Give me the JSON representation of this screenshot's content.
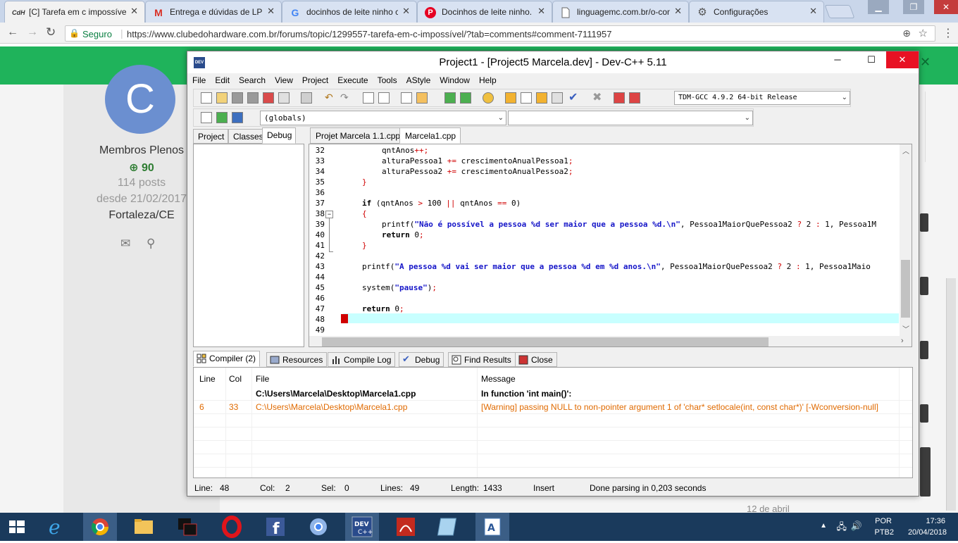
{
  "browser": {
    "tabs": [
      {
        "favicon": "CdH",
        "title": "[C] Tarefa em c impossíve",
        "active": true
      },
      {
        "favicon": "M",
        "title": "Entrega e dúvidas de LPC",
        "active": false
      },
      {
        "favicon": "G",
        "title": "docinhos de leite ninho c",
        "active": false
      },
      {
        "favicon": "P",
        "title": "Docinhos de leite ninho.",
        "active": false
      },
      {
        "favicon": "doc",
        "title": "linguagemc.com.br/o-con",
        "active": false
      },
      {
        "favicon": "gear",
        "title": "Configurações",
        "active": false
      }
    ],
    "secure_label": "Seguro",
    "url": "https://www.clubedohardware.com.br/forums/topic/1299557-tarefa-em-c-impossível/?tab=comments#comment-7111957"
  },
  "profile": {
    "avatar_letter": "C",
    "group": "Membros Plenos",
    "reputation": "90",
    "posts": "114 posts",
    "since": "desde 21/02/2017",
    "location": "Fortaleza/CE"
  },
  "right_date": "12 de abril",
  "devcpp": {
    "title": "Project1 - [Project5 Marcela.dev] - Dev-C++ 5.11",
    "menu": [
      "File",
      "Edit",
      "Search",
      "View",
      "Project",
      "Execute",
      "Tools",
      "AStyle",
      "Window",
      "Help"
    ],
    "compiler_select": "TDM-GCC 4.9.2 64-bit Release",
    "scope_select": "(globals)",
    "left_tabs": [
      "Project",
      "Classes",
      "Debug"
    ],
    "editor_tabs": [
      "Projet Marcela 1.1.cpp",
      "Marcela1.cpp"
    ],
    "code_lines": [
      {
        "n": "32",
        "text": "qntAnos++;"
      },
      {
        "n": "33",
        "text": "alturaPessoa1 += crescimentoAnualPessoa1;"
      },
      {
        "n": "34",
        "text": "alturaPessoa2 += crescimentoAnualPessoa2;"
      },
      {
        "n": "35",
        "text": "}"
      },
      {
        "n": "36",
        "text": ""
      },
      {
        "n": "37",
        "text": "if (qntAnos > 100 || qntAnos == 0)"
      },
      {
        "n": "38",
        "text": "{"
      },
      {
        "n": "39",
        "text": "printf(\"Não é possível a pessoa %d ser maior que a pessoa %d.\\n\", Pessoa1MaiorQuePessoa2 ? 2 : 1, Pessoa1M"
      },
      {
        "n": "40",
        "text": "return 0;"
      },
      {
        "n": "41",
        "text": "}"
      },
      {
        "n": "42",
        "text": ""
      },
      {
        "n": "43",
        "text": "printf(\"A pessoa %d vai ser maior que a pessoa %d em %d anos.\\n\", Pessoa1MaiorQuePessoa2 ? 2 : 1, Pessoa1Maio"
      },
      {
        "n": "44",
        "text": ""
      },
      {
        "n": "45",
        "text": "system(\"pause\");"
      },
      {
        "n": "46",
        "text": ""
      },
      {
        "n": "47",
        "text": "return 0;"
      },
      {
        "n": "48",
        "text": "}"
      },
      {
        "n": "49",
        "text": ""
      }
    ],
    "bottom_tabs": [
      "Compiler (2)",
      "Resources",
      "Compile Log",
      "Debug",
      "Find Results",
      "Close"
    ],
    "msg_headers": {
      "line": "Line",
      "col": "Col",
      "file": "File",
      "message": "Message"
    },
    "messages": [
      {
        "line": "",
        "col": "",
        "file": "C:\\Users\\Marcela\\Desktop\\Marcela1.cpp",
        "message": "In function 'int main()':",
        "bold": true
      },
      {
        "line": "6",
        "col": "33",
        "file": "C:\\Users\\Marcela\\Desktop\\Marcela1.cpp",
        "message": "[Warning] passing NULL to non-pointer argument 1 of 'char* setlocale(int, const char*)' [-Wconversion-null]",
        "bold": false
      }
    ],
    "status": {
      "line_label": "Line:",
      "line": "48",
      "col_label": "Col:",
      "col": "2",
      "sel_label": "Sel:",
      "sel": "0",
      "lines_label": "Lines:",
      "lines": "49",
      "length_label": "Length:",
      "length": "1433",
      "mode": "Insert",
      "message": "Done parsing in 0,203 seconds"
    }
  },
  "taskbar": {
    "lang_top": "POR",
    "lang_bottom": "PTB2",
    "time": "17:36",
    "date": "20/04/2018"
  },
  "colors": {
    "warning_text": "#e06a00",
    "site_green": "#1fb35b",
    "highlight_line": "#c8ffff"
  }
}
